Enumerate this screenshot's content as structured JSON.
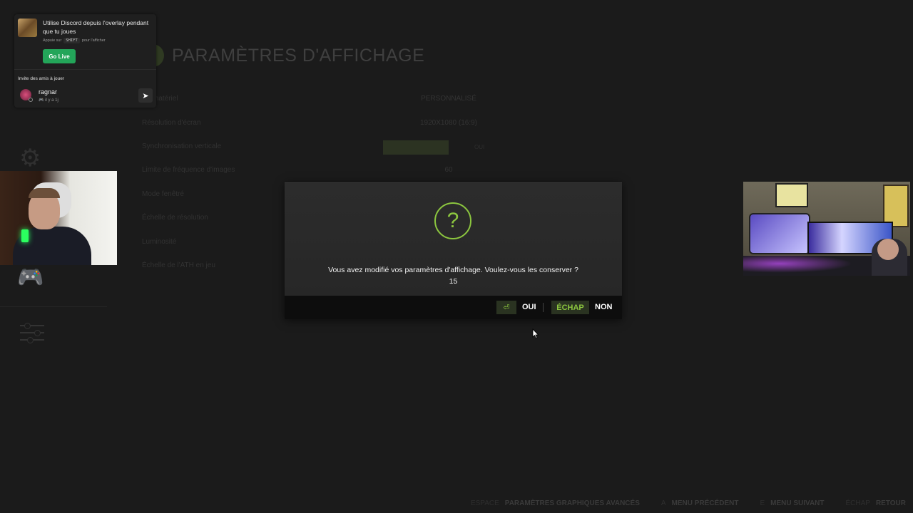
{
  "page": {
    "title": "PARAMÈTRES D'AFFICHAGE"
  },
  "settings": [
    {
      "label": "…l matériel",
      "value": "PERSONNALISÉ"
    },
    {
      "label": "Résolution d'écran",
      "value": "1920X1080 (16:9)"
    },
    {
      "label": "Synchronisation verticale",
      "toggle_on": "",
      "toggle_off": "OUI"
    },
    {
      "label": "Limite de fréquence d'images",
      "value": "60"
    },
    {
      "label": "Mode fenêtré",
      "value": ""
    },
    {
      "label": "Échelle de résolution",
      "value": ""
    },
    {
      "label": "Luminosité",
      "value": ""
    },
    {
      "label": "Échelle de l'ATH en jeu",
      "value": ""
    }
  ],
  "footer": {
    "items": [
      {
        "key": "ESPACE",
        "label": "PARAMÈTRES GRAPHIQUES AVANCÉS"
      },
      {
        "key": "A",
        "label": "MENU PRÉCÉDENT"
      },
      {
        "key": "E",
        "label": "MENU SUIVANT"
      },
      {
        "key": "ÉCHAP",
        "label": "RETOUR"
      }
    ]
  },
  "discord": {
    "title": "Utilise Discord depuis l'overlay pendant que tu joues",
    "hint_prefix": "Appuie sur",
    "hint_key": "SHIFT",
    "hint_suffix": "pour l'afficher",
    "go_live": "Go Live",
    "invite_label": "Invite des amis à jouer",
    "friend_name": "ragnar",
    "friend_sub": "🎮 il y a 1j",
    "arrow": "➤"
  },
  "dialog": {
    "message": "Vous avez modifié vos paramètres d'affichage. Voulez-vous les conserver ?",
    "countdown": "15",
    "icon": "?",
    "enter_key": "⏎",
    "yes_label": "OUI",
    "escape_key": "ÉCHAP",
    "no_label": "NON"
  },
  "colors": {
    "accent": "#8cc63f",
    "background": "#1b1b1b",
    "discord_green": "#23a559"
  },
  "icons": {
    "nav_gear": "⚙",
    "nav_controller": "🎮"
  }
}
